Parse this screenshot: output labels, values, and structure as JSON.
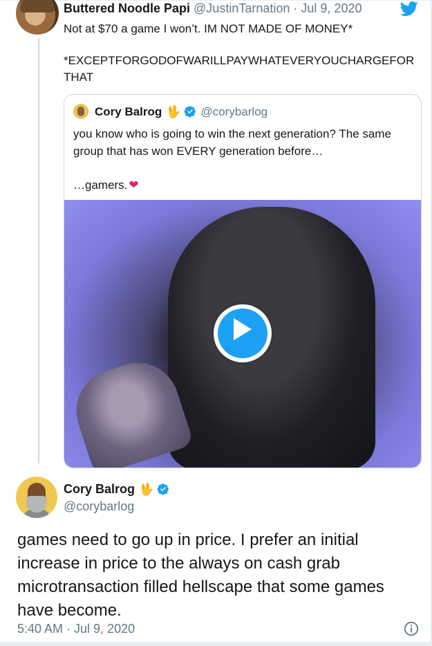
{
  "parent_tweet": {
    "display_name": "Buttered Noodle Papi",
    "handle": "@JustinTarnation",
    "separator": "·",
    "date": "Jul 9, 2020",
    "text_line1": "Not at $70 a game I won’t. IM NOT MADE OF MONEY*",
    "text_line2": "*EXCEPTFORGODOFWARILLPAYWHATEVERYOUCHARGEFOR THAT"
  },
  "quoted_tweet": {
    "display_name": "Cory Balrog",
    "emoji": "🖖",
    "handle": "@corybarlog",
    "text_line1": "you know who is going to win the next generation? The same group that has won EVERY generation before…",
    "text_line2": "…gamers.",
    "heart": "❤",
    "media_type": "video"
  },
  "main_tweet": {
    "display_name": "Cory Balrog",
    "emoji": "🖖",
    "handle": "@corybarlog",
    "text": "games need to go up in price. I prefer an initial increase in price to the always on cash grab microtransaction filled hellscape that some games have become.",
    "timestamp": "5:40 AM · Jul 9, 2020"
  },
  "colors": {
    "twitter_blue": "#1da1f2",
    "text": "#14171a",
    "secondary_text": "#657786",
    "border": "#ccd6dd",
    "heart": "#e0245e"
  },
  "icons": [
    "twitter-bird-icon",
    "verified-badge-icon",
    "play-icon",
    "info-icon",
    "vulcan-salute-emoji"
  ]
}
